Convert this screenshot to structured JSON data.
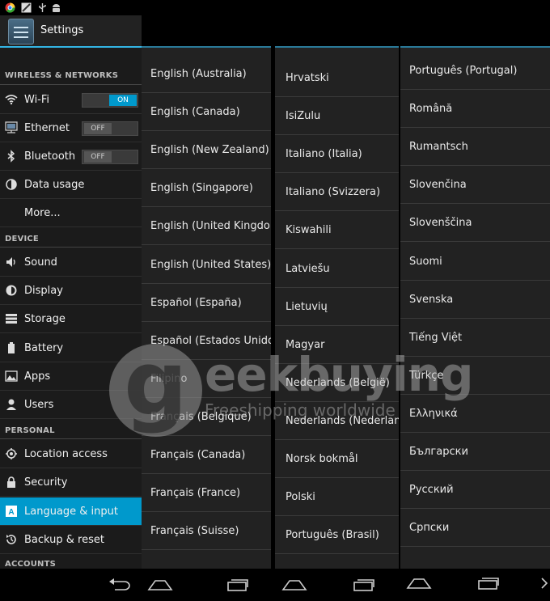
{
  "header": {
    "title": "Settings"
  },
  "sections": {
    "wireless": "WIRELESS & NETWORKS",
    "device": "DEVICE",
    "personal": "PERSONAL",
    "accounts": "ACCOUNTS"
  },
  "settings_items": {
    "wifi": {
      "label": "Wi-Fi",
      "toggle": "ON"
    },
    "ethernet": {
      "label": "Ethernet",
      "toggle": "OFF"
    },
    "bluetooth": {
      "label": "Bluetooth",
      "toggle": "OFF"
    },
    "data_usage": {
      "label": "Data usage"
    },
    "more": {
      "label": "More..."
    },
    "sound": {
      "label": "Sound"
    },
    "display": {
      "label": "Display"
    },
    "storage": {
      "label": "Storage"
    },
    "battery": {
      "label": "Battery"
    },
    "apps": {
      "label": "Apps"
    },
    "users": {
      "label": "Users"
    },
    "location": {
      "label": "Location access"
    },
    "security": {
      "label": "Security"
    },
    "language": {
      "label": "Language & input"
    },
    "backup": {
      "label": "Backup & reset"
    }
  },
  "language_columns": [
    [
      "English (Australia)",
      "English (Canada)",
      "English (New Zealand)",
      "English (Singapore)",
      "English (United Kingdom",
      "English (United States)",
      "Español (España)",
      "Español (Estados Unido",
      "Filipino",
      "Français (Belgique)",
      "Français (Canada)",
      "Français (France)",
      "Français (Suisse)"
    ],
    [
      "Hrvatski",
      "IsiZulu",
      "Italiano (Italia)",
      "Italiano (Svizzera)",
      "Kiswahili",
      "Latviešu",
      "Lietuvių",
      "Magyar",
      "Nederlands (België)",
      "Nederlands (Nederland)",
      "Norsk bokmål",
      "Polski",
      "Português (Brasil)"
    ],
    [
      "Português (Portugal)",
      "Română",
      "Rumantsch",
      "Slovenčina",
      "Slovenščina",
      "Suomi",
      "Svenska",
      "Tiếng Việt",
      "Türkçe",
      "Ελληνικά",
      "Български",
      "Русский",
      "Српски"
    ]
  ],
  "watermark": {
    "brand": "eekbuying",
    "letter": "g",
    "tagline": "Freeshipping worldwide"
  },
  "colors": {
    "accent": "#0099cc",
    "actionbar_line": "#33b5e5",
    "background": "#1b1b1b"
  }
}
